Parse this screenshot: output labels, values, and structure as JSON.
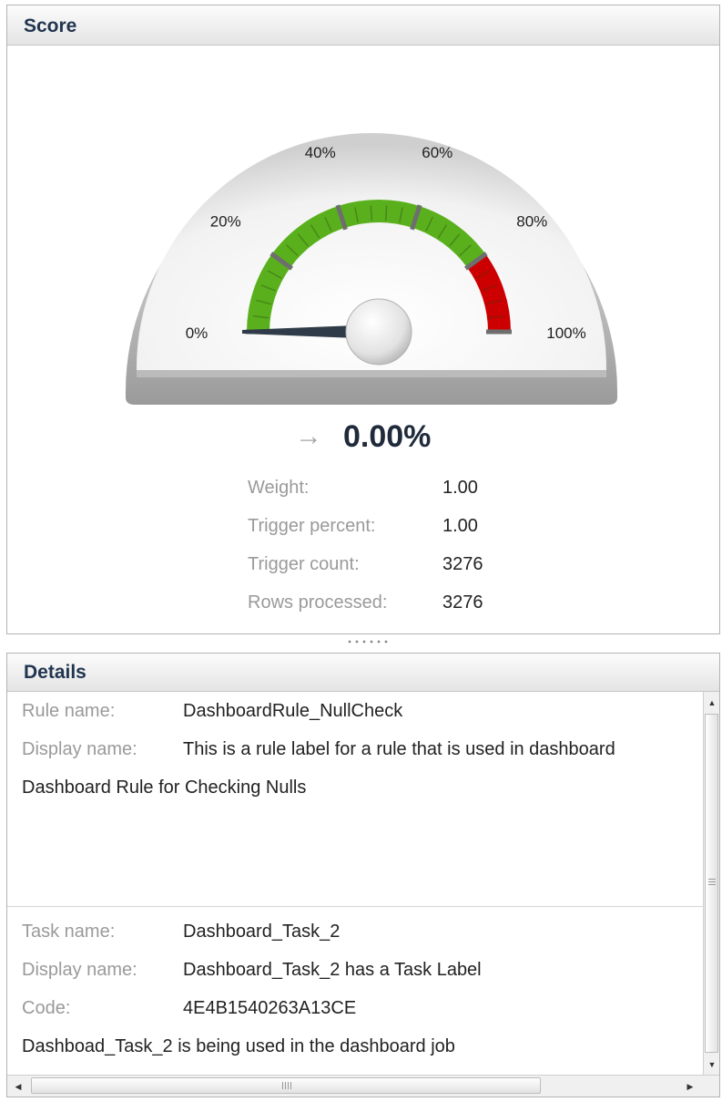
{
  "score_panel": {
    "title": "Score",
    "gauge": {
      "min": 0,
      "max": 100,
      "value": 0,
      "tick_labels": [
        "0%",
        "20%",
        "40%",
        "60%",
        "80%",
        "100%"
      ],
      "bands": [
        {
          "from": 0,
          "to": 80,
          "color": "#59b01c"
        },
        {
          "from": 80,
          "to": 100,
          "color": "#cc0000"
        }
      ]
    },
    "trend_icon": "right-arrow-icon",
    "trend_glyph": "→",
    "score_text": "0.00%",
    "stats": [
      {
        "label": "Weight:",
        "value": "1.00"
      },
      {
        "label": "Trigger percent:",
        "value": "1.00"
      },
      {
        "label": "Trigger count:",
        "value": "3276"
      },
      {
        "label": "Rows processed:",
        "value": "3276"
      }
    ]
  },
  "details_panel": {
    "title": "Details",
    "rule": {
      "name_label": "Rule name:",
      "name": "DashboardRule_NullCheck",
      "display_label": "Display name:",
      "display": "This is a rule label for a rule that is used in dashboard",
      "description": "Dashboard Rule for Checking Nulls"
    },
    "task": {
      "name_label": "Task name:",
      "name": "Dashboard_Task_2",
      "display_label": "Display name:",
      "display": "Dashboard_Task_2 has a Task Label",
      "code_label": "Code:",
      "code": "4E4B1540263A13CE",
      "description": "Dashboad_Task_2 is being used in the dashboard job"
    }
  }
}
